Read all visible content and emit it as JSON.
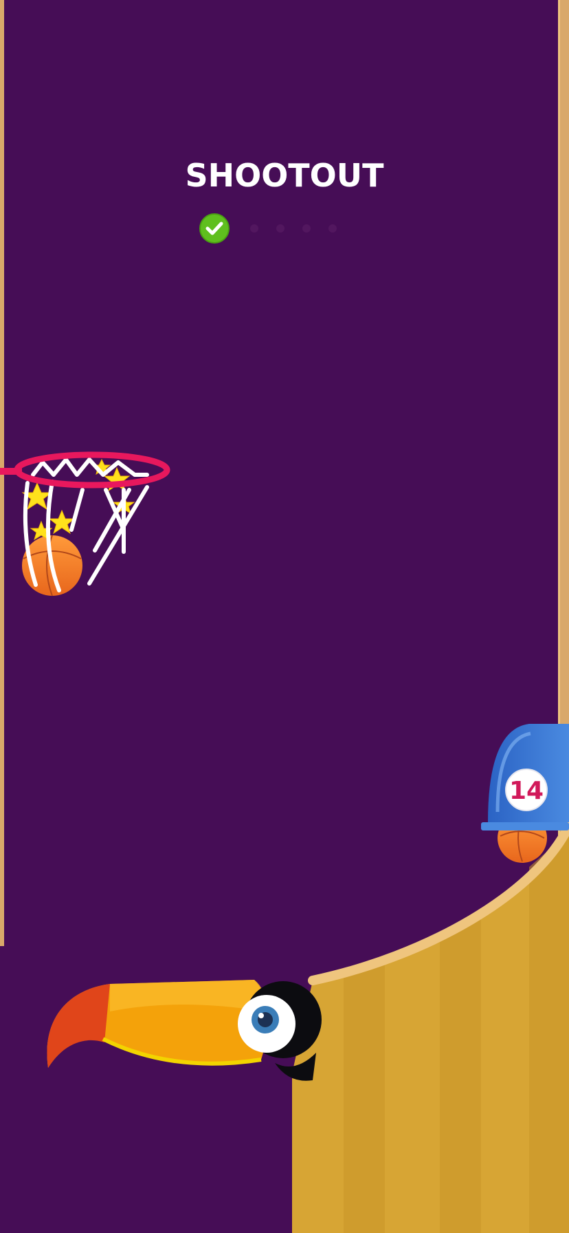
{
  "game": {
    "mode_title": "SHOOTOUT",
    "shots_made": 1,
    "shots_total": 5,
    "balls_remaining": "14"
  },
  "colors": {
    "background": "#460d56",
    "rim": "#e8185d",
    "ramp": "#d7a534",
    "ramp_edge": "#efc57e",
    "dispenser": "#2f6fc7",
    "check": "#5fbf1e",
    "toucan_beak": "#f4a20a",
    "toucan_beak_tip": "#e0451a"
  }
}
